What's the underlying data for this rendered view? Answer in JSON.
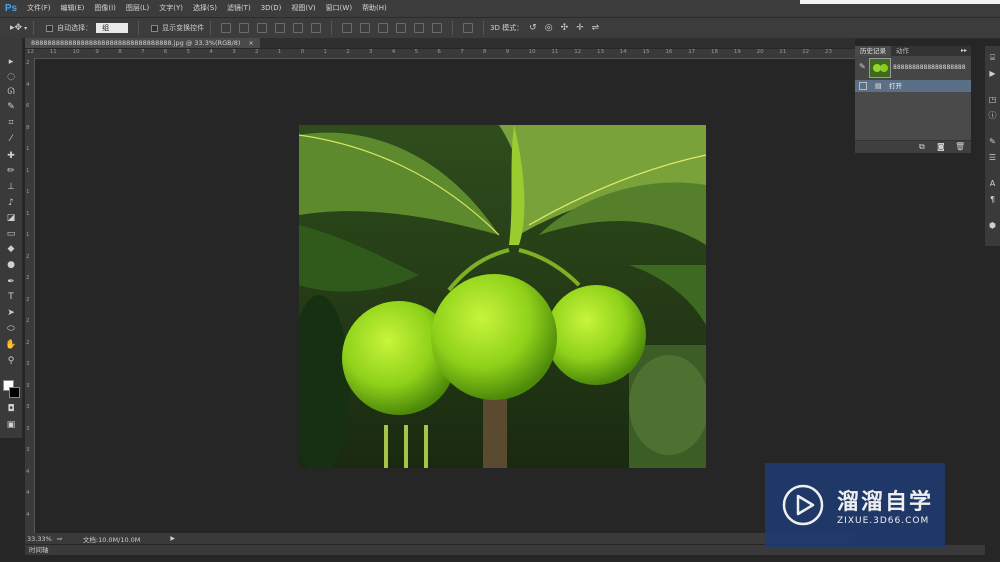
{
  "app": {
    "logo": "Ps"
  },
  "menu": {
    "items": [
      "文件(F)",
      "编辑(E)",
      "图像(I)",
      "图层(L)",
      "文字(Y)",
      "选择(S)",
      "滤镜(T)",
      "3D(D)",
      "视图(V)",
      "窗口(W)",
      "帮助(H)"
    ]
  },
  "options_bar": {
    "auto_select_label": "自动选择：",
    "auto_select_value": "组",
    "show_transform_label": "显示变换控件",
    "mode_3d_label": "3D 模式："
  },
  "document": {
    "tab_title": "8888888888888888888888888888888888.jpg @ 33.3%(RGB/8)",
    "close_glyph": "×"
  },
  "rulers": {
    "top": [
      "12",
      "11",
      "10",
      "9",
      "8",
      "7",
      "6",
      "5",
      "4",
      "3",
      "2",
      "1",
      "0",
      "1",
      "2",
      "3",
      "4",
      "5",
      "6",
      "7",
      "8",
      "9",
      "10",
      "11",
      "12",
      "13",
      "14",
      "15",
      "16",
      "17",
      "18",
      "19",
      "20",
      "21",
      "22",
      "23"
    ],
    "left": [
      "2",
      "4",
      "6",
      "8",
      "1",
      "1",
      "1",
      "1",
      "1",
      "2",
      "2",
      "2",
      "2",
      "2",
      "3",
      "3",
      "3",
      "3",
      "3",
      "4",
      "4",
      "4"
    ]
  },
  "statusbar": {
    "zoom": "33.33%",
    "doc_info": "文档:10.0M/10.0M"
  },
  "timeline": {
    "label": "时间轴"
  },
  "history_panel": {
    "tabs": [
      "历史记录",
      "动作"
    ],
    "snapshot_name": "8888888888888888888",
    "open_step": "打开"
  },
  "watermark": {
    "title": "溜溜自学",
    "url": "ZIXUE.3D66.COM"
  },
  "colors": {
    "accent": "#4aa3e8",
    "watermark_bg": "#1f3a6e",
    "history_selected": "#5b6f86"
  }
}
